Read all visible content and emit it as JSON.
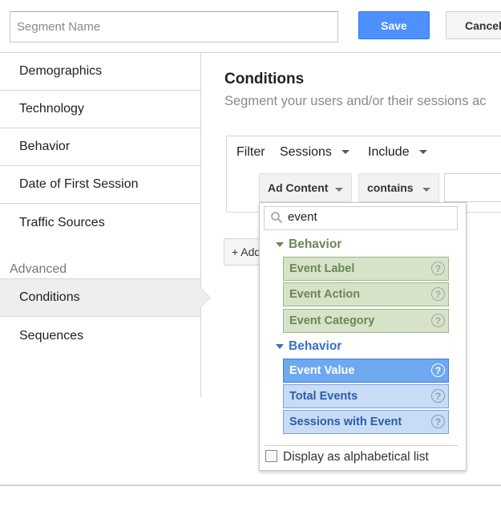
{
  "header": {
    "segment_name_placeholder": "Segment Name",
    "save_label": "Save",
    "cancel_label": "Cancel"
  },
  "sidebar": {
    "items": [
      {
        "label": "Demographics"
      },
      {
        "label": "Technology"
      },
      {
        "label": "Behavior"
      },
      {
        "label": "Date of First Session"
      },
      {
        "label": "Traffic Sources"
      }
    ],
    "advanced_heading": "Advanced",
    "advanced_items": [
      {
        "label": "Conditions",
        "active": true
      },
      {
        "label": "Sequences"
      }
    ]
  },
  "main": {
    "title": "Conditions",
    "subtitle": "Segment your users and/or their sessions ac",
    "filter": {
      "label": "Filter",
      "scope": "Sessions",
      "mode": "Include",
      "dimension": "Ad Content",
      "operator": "contains",
      "value": ""
    },
    "add_label": "+ Add"
  },
  "dropdown": {
    "search_value": "event",
    "groups": [
      {
        "heading": "Behavior",
        "color": "#6c8657",
        "options": [
          {
            "label": "Event Label",
            "style": "green"
          },
          {
            "label": "Event Action",
            "style": "green"
          },
          {
            "label": "Event Category",
            "style": "green"
          }
        ]
      },
      {
        "heading": "Behavior",
        "color": "#3a6fc4",
        "options": [
          {
            "label": "Event Value",
            "style": "blue-selected"
          },
          {
            "label": "Total Events",
            "style": "blue"
          },
          {
            "label": "Sessions with Event",
            "style": "blue"
          }
        ]
      }
    ],
    "help_glyph": "?",
    "alphabetical_label": "Display as alphabetical list",
    "alphabetical_checked": false
  }
}
